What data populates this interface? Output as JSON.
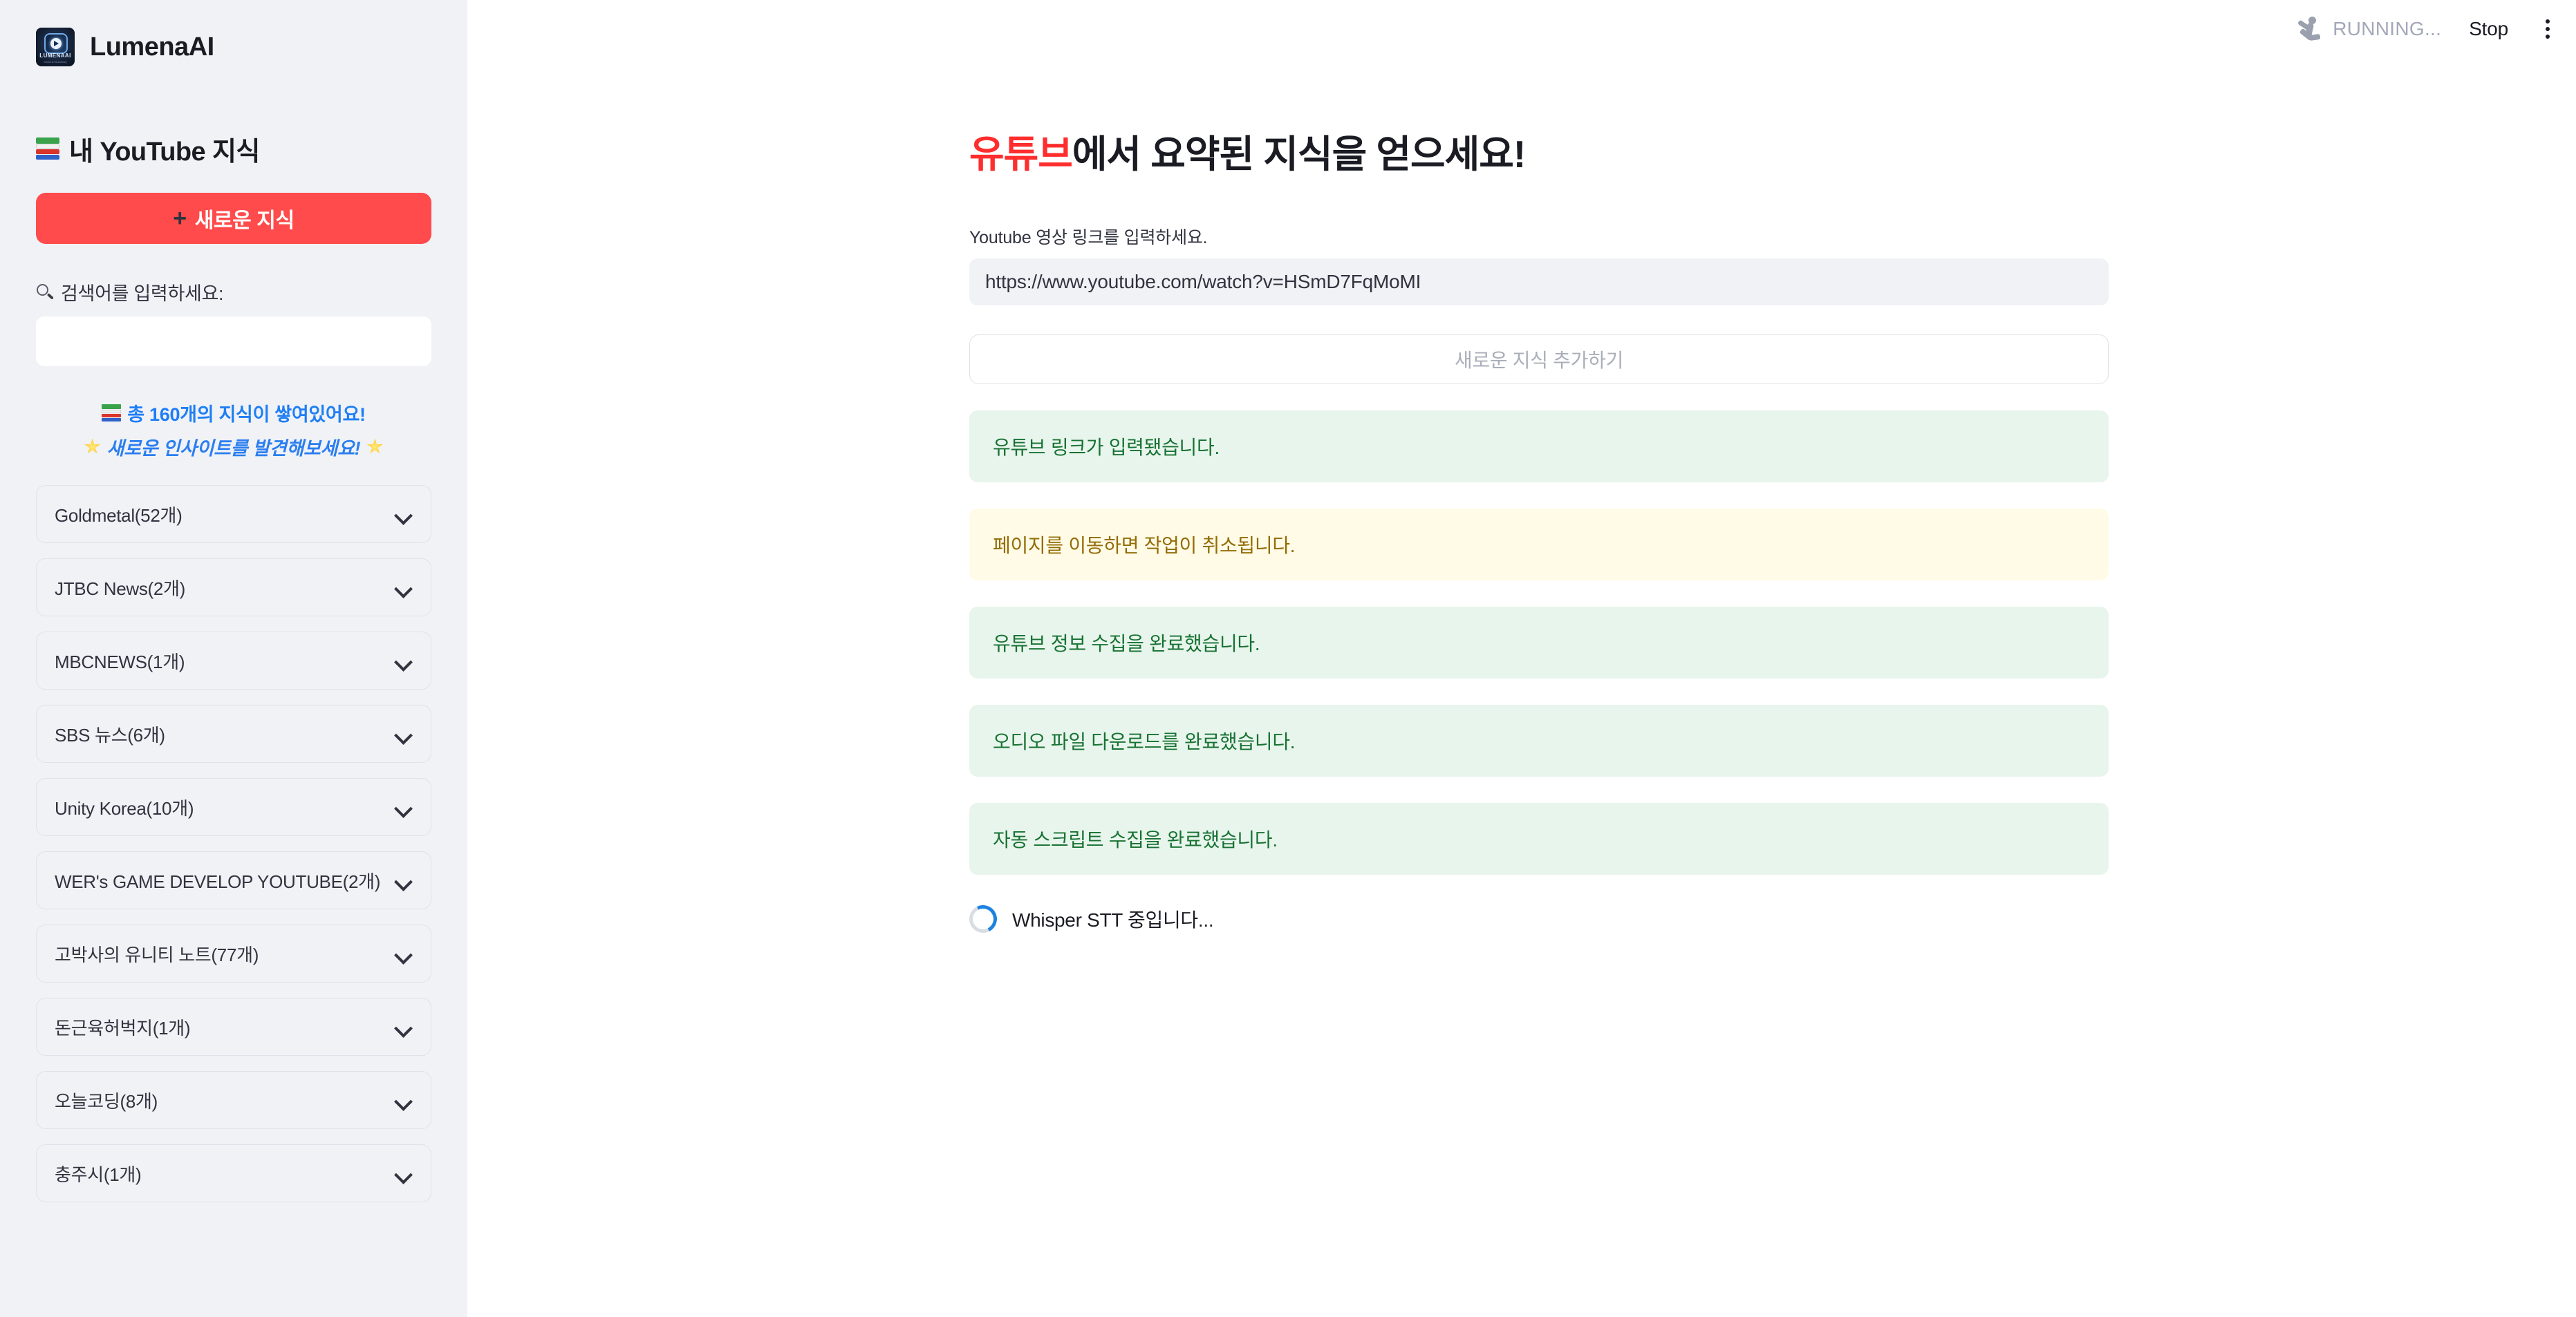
{
  "app": {
    "brand_name": "LumenaAI",
    "logo_text": "LUMENAAI",
    "logo_subtext": "Smart AI Summary"
  },
  "topbar": {
    "status_text": "RUNNING...",
    "stop_label": "Stop",
    "menu_icon": "kebab-menu-icon"
  },
  "sidebar": {
    "heading": "내 YouTube 지식",
    "new_knowledge_button": "새로운 지식",
    "new_knowledge_plus": "+",
    "search_label": "검색어를 입력하세요:",
    "search_value": "",
    "search_placeholder": "",
    "count_line": "총 160개의 지식이 쌓여있어요!",
    "insight_line": "새로운 인사이트를 발견해보세요!",
    "total_count": 160,
    "channels": [
      {
        "label": "Goldmetal(52개)",
        "name": "Goldmetal",
        "count": 52
      },
      {
        "label": "JTBC News(2개)",
        "name": "JTBC News",
        "count": 2
      },
      {
        "label": "MBCNEWS(1개)",
        "name": "MBCNEWS",
        "count": 1
      },
      {
        "label": "SBS 뉴스(6개)",
        "name": "SBS 뉴스",
        "count": 6
      },
      {
        "label": "Unity Korea(10개)",
        "name": "Unity Korea",
        "count": 10
      },
      {
        "label": "WER's GAME DEVELOP YOUTUBE(2개)",
        "name": "WER's GAME DEVELOP YOUTUBE",
        "count": 2
      },
      {
        "label": "고박사의 유니티 노트(77개)",
        "name": "고박사의 유니티 노트",
        "count": 77
      },
      {
        "label": "돈근육허벅지(1개)",
        "name": "돈근육허벅지",
        "count": 1
      },
      {
        "label": "오늘코딩(8개)",
        "name": "오늘코딩",
        "count": 8
      },
      {
        "label": "충주시(1개)",
        "name": "충주시",
        "count": 1
      }
    ]
  },
  "main": {
    "title_highlight": "유튜브",
    "title_rest": "에서 요약된 지식을 얻으세요!",
    "url_field_label": "Youtube 영상 링크를 입력하세요.",
    "url_value": "https://www.youtube.com/watch?v=HSmD7FqMoMI",
    "url_placeholder": "",
    "add_button_label": "새로운 지식 추가하기",
    "messages": [
      {
        "type": "success",
        "text": "유튜브 링크가 입력됐습니다."
      },
      {
        "type": "warning",
        "text": "페이지를 이동하면 작업이 취소됩니다."
      },
      {
        "type": "success",
        "text": "유튜브 정보 수집을 완료했습니다."
      },
      {
        "type": "success",
        "text": "오디오 파일 다운로드를 완료했습니다."
      },
      {
        "type": "success",
        "text": "자동 스크립트 수집을 완료했습니다."
      }
    ],
    "spinner_text": "Whisper STT 중입니다..."
  },
  "colors": {
    "accent_red": "#ff4b4b",
    "title_red": "#ff2e2e",
    "sidebar_bg": "#f0f2f6",
    "success_bg": "#e8f5ec",
    "success_fg": "#177233",
    "warning_bg": "#fffbe6",
    "warning_fg": "#926c05",
    "link_blue": "#1f7ef5",
    "spinner_blue": "#1c83e1"
  }
}
